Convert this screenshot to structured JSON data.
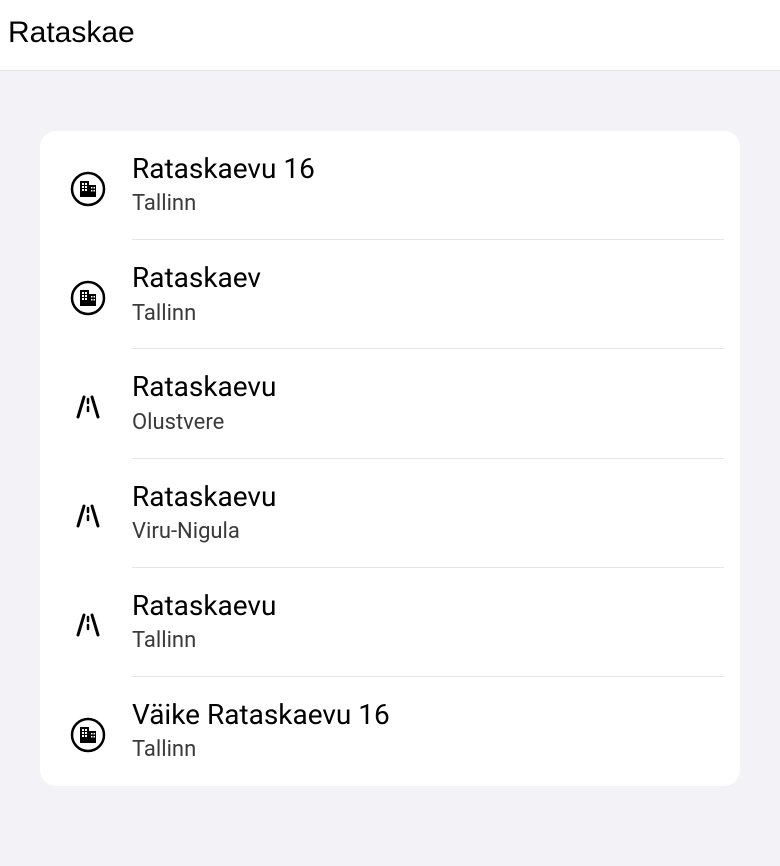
{
  "search": {
    "value": "Rataskae"
  },
  "results": [
    {
      "title": "Rataskaevu 16",
      "subtitle": "Tallinn",
      "icon": "city"
    },
    {
      "title": "Rataskaev",
      "subtitle": "Tallinn",
      "icon": "city"
    },
    {
      "title": "Rataskaevu",
      "subtitle": "Olustvere",
      "icon": "road"
    },
    {
      "title": "Rataskaevu",
      "subtitle": "Viru-Nigula",
      "icon": "road"
    },
    {
      "title": "Rataskaevu",
      "subtitle": "Tallinn",
      "icon": "road"
    },
    {
      "title": "Väike Rataskaevu 16",
      "subtitle": "Tallinn",
      "icon": "city"
    }
  ]
}
